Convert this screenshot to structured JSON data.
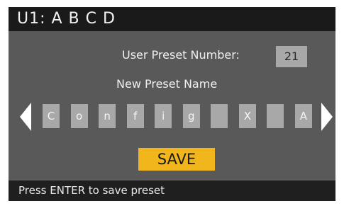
{
  "title_bar": {
    "text": "U1: A B C D"
  },
  "preset_number": {
    "label": "User Preset Number:",
    "value": "21"
  },
  "preset_name": {
    "label": "New Preset Name",
    "characters": [
      "C",
      "o",
      "n",
      "f",
      "i",
      "g",
      "",
      "X",
      "",
      "A"
    ]
  },
  "save": {
    "label": "SAVE"
  },
  "status": {
    "text": "Press ENTER to save preset"
  },
  "colors": {
    "screen_bg": "#595959",
    "bar_bg": "#1a1a1a",
    "field_bg": "#a8a8a8",
    "save_bg": "#f2b61d"
  },
  "icons": {
    "left": "arrow-left-icon",
    "right": "arrow-right-icon"
  }
}
